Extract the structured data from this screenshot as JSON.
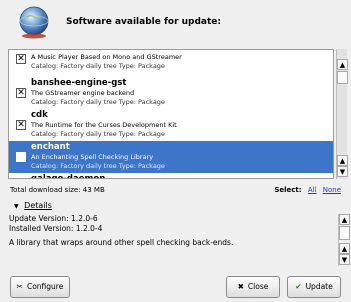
{
  "header": {
    "title": "Software available for update:",
    "icon": "globe-update-icon"
  },
  "packages": [
    {
      "name": "",
      "description": "A Music Player Based on Mono and GStreamer",
      "catalog": "Catalog: Factory daily tree Type: Package",
      "checked": true,
      "selected": false
    },
    {
      "name": "banshee-engine-gst",
      "description": "The GStreamer engine backend",
      "catalog": "Catalog: Factory daily tree Type: Package",
      "checked": true,
      "selected": false
    },
    {
      "name": "cdk",
      "description": "The Runtime for the Curses Development Kit",
      "catalog": "Catalog: Factory daily tree Type: Package",
      "checked": true,
      "selected": false
    },
    {
      "name": "enchant",
      "description": "An Enchanting Spell Checking Library",
      "catalog": "Catalog: Factory daily tree Type: Package",
      "checked": true,
      "selected": true
    },
    {
      "name": "galago-daemon",
      "description": "",
      "catalog": "",
      "checked": false,
      "selected": false
    }
  ],
  "summary": {
    "download_size": "Total download size: 43 MB",
    "select_label": "Select:",
    "select_all": "All",
    "select_none": "None"
  },
  "details": {
    "toggle_label": "Details",
    "update_version": "Update Version: 1.2.0-6",
    "installed_version": "Installed Version: 1.2.0-4",
    "description": "A library that wraps around other spell checking back-ends."
  },
  "buttons": {
    "configure": "Configure",
    "close": "Close",
    "update": "Update"
  },
  "colors": {
    "selection": "#3d75c8",
    "link": "#1a3ec2",
    "window_bg": "#efefef"
  }
}
